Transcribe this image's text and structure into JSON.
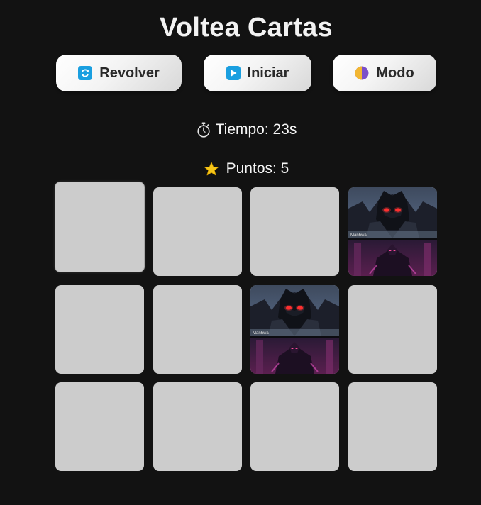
{
  "title": "Voltea Cartas",
  "buttons": {
    "shuffle": {
      "label": "Revolver",
      "icon": "shuffle-icon"
    },
    "start": {
      "label": "Iniciar",
      "icon": "play-icon"
    },
    "mode": {
      "label": "Modo",
      "icon": "half-moon-icon"
    }
  },
  "stats": {
    "time": {
      "label": "Tiempo: 23s",
      "icon": "stopwatch-icon"
    },
    "score": {
      "label": "Puntos: 5",
      "icon": "star-icon"
    }
  },
  "grid": {
    "rows": 3,
    "cols": 4,
    "cards": [
      {
        "state": "hidden"
      },
      {
        "state": "hidden"
      },
      {
        "state": "hidden"
      },
      {
        "state": "revealed",
        "image": "dark-armored-warrior"
      },
      {
        "state": "hidden"
      },
      {
        "state": "hidden"
      },
      {
        "state": "revealed",
        "image": "dark-armored-warrior"
      },
      {
        "state": "hidden"
      },
      {
        "state": "hidden"
      },
      {
        "state": "hidden"
      },
      {
        "state": "hidden"
      },
      {
        "state": "hidden"
      }
    ]
  },
  "colors": {
    "background": "#121212",
    "card_back": "#cccccc",
    "accent_blue": "#1a9fe0",
    "star": "#f5c518"
  }
}
